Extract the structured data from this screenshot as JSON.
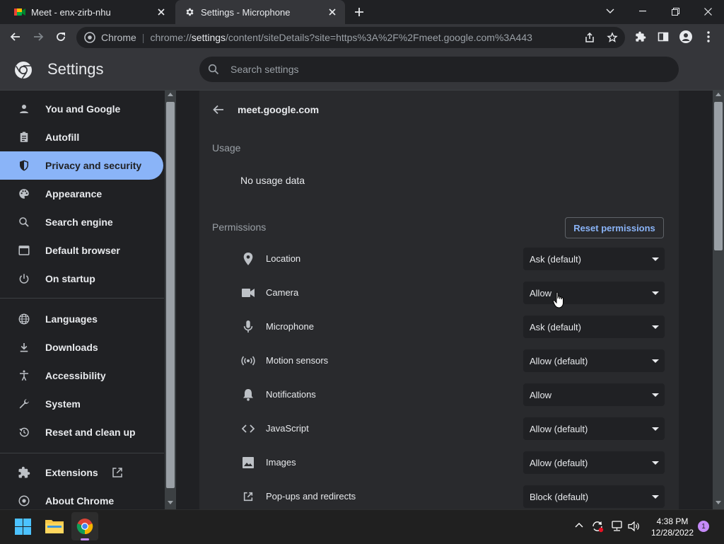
{
  "tabs": [
    {
      "title": "Meet - enx-zirb-nhu"
    },
    {
      "title": "Settings - Microphone"
    }
  ],
  "omnibox": {
    "chip": "Chrome",
    "url_prefix": "chrome://",
    "url_host": "settings",
    "url_rest": "/content/siteDetails?site=https%3A%2F%2Fmeet.google.com%3A443"
  },
  "header": {
    "title": "Settings",
    "search_placeholder": "Search settings"
  },
  "sidebar": {
    "items": [
      {
        "label": "You and Google",
        "icon": "person-icon"
      },
      {
        "label": "Autofill",
        "icon": "clipboard-icon"
      },
      {
        "label": "Privacy and security",
        "icon": "shield-icon",
        "active": true
      },
      {
        "label": "Appearance",
        "icon": "palette-icon"
      },
      {
        "label": "Search engine",
        "icon": "search-icon"
      },
      {
        "label": "Default browser",
        "icon": "browser-icon"
      },
      {
        "label": "On startup",
        "icon": "power-icon"
      },
      {
        "label": "Languages",
        "icon": "globe-icon"
      },
      {
        "label": "Downloads",
        "icon": "download-icon"
      },
      {
        "label": "Accessibility",
        "icon": "accessibility-icon"
      },
      {
        "label": "System",
        "icon": "wrench-icon"
      },
      {
        "label": "Reset and clean up",
        "icon": "history-icon"
      },
      {
        "label": "Extensions",
        "icon": "puzzle-icon"
      },
      {
        "label": "About Chrome",
        "icon": "chrome-logo-icon"
      }
    ]
  },
  "site": {
    "title": "meet.google.com",
    "usage_heading": "Usage",
    "usage_value": "No usage data",
    "permissions_heading": "Permissions",
    "reset_button": "Reset permissions",
    "permissions": [
      {
        "label": "Location",
        "value": "Ask (default)",
        "icon": "location-pin-icon"
      },
      {
        "label": "Camera",
        "value": "Allow",
        "icon": "camera-icon"
      },
      {
        "label": "Microphone",
        "value": "Ask (default)",
        "icon": "microphone-icon"
      },
      {
        "label": "Motion sensors",
        "value": "Allow (default)",
        "icon": "sensors-icon"
      },
      {
        "label": "Notifications",
        "value": "Allow",
        "icon": "bell-icon"
      },
      {
        "label": "JavaScript",
        "value": "Allow (default)",
        "icon": "code-icon"
      },
      {
        "label": "Images",
        "value": "Allow (default)",
        "icon": "image-icon"
      },
      {
        "label": "Pop-ups and redirects",
        "value": "Block (default)",
        "icon": "open-in-new-icon"
      }
    ]
  },
  "taskbar": {
    "time": "4:38 PM",
    "date": "12/28/2022",
    "notifications": "1"
  },
  "colors": {
    "accent": "#8ab4f8",
    "surface": "#292a2d",
    "background": "#202124"
  }
}
